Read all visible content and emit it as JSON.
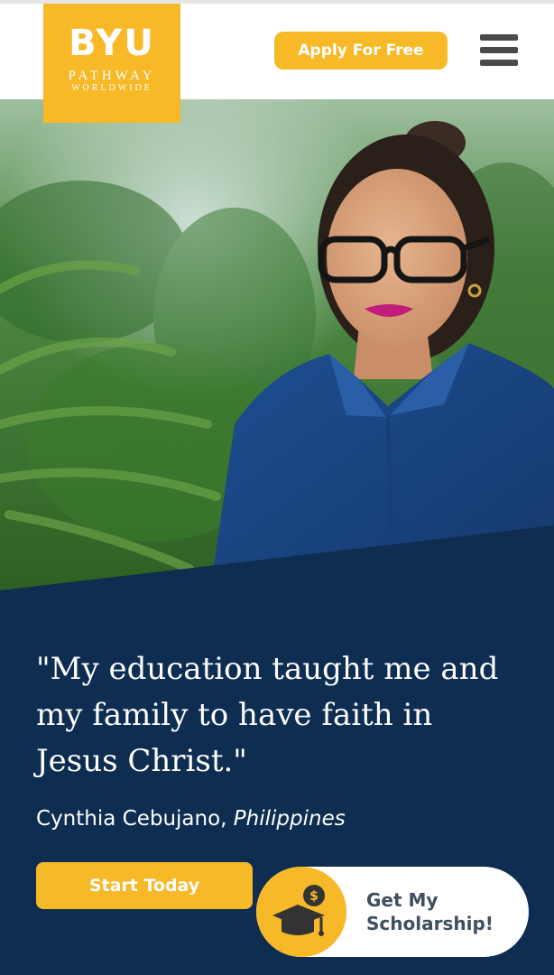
{
  "header": {
    "logo": {
      "main": "BYU",
      "line1": "PATHWAY",
      "line2": "WORLDWIDE"
    },
    "apply_button": "Apply For Free",
    "menu_icon": "hamburger-menu-icon"
  },
  "hero": {
    "image": "woman-portrait-photo"
  },
  "testimonial": {
    "quote": "\"My education taught me and my family to have faith in Jesus Christ.\"",
    "name": "Cynthia Cebujano",
    "separator": ", ",
    "location": "Philippines"
  },
  "cta": {
    "start_button": "Start Today",
    "scholarship_line1": "Get My",
    "scholarship_line2": "Scholarship!",
    "scholarship_icon": "graduation-cap-money-icon"
  },
  "colors": {
    "brand_gold": "#f7b928",
    "navy": "#0e2d51",
    "white": "#ffffff",
    "menu_gray": "#4a4a4a"
  }
}
